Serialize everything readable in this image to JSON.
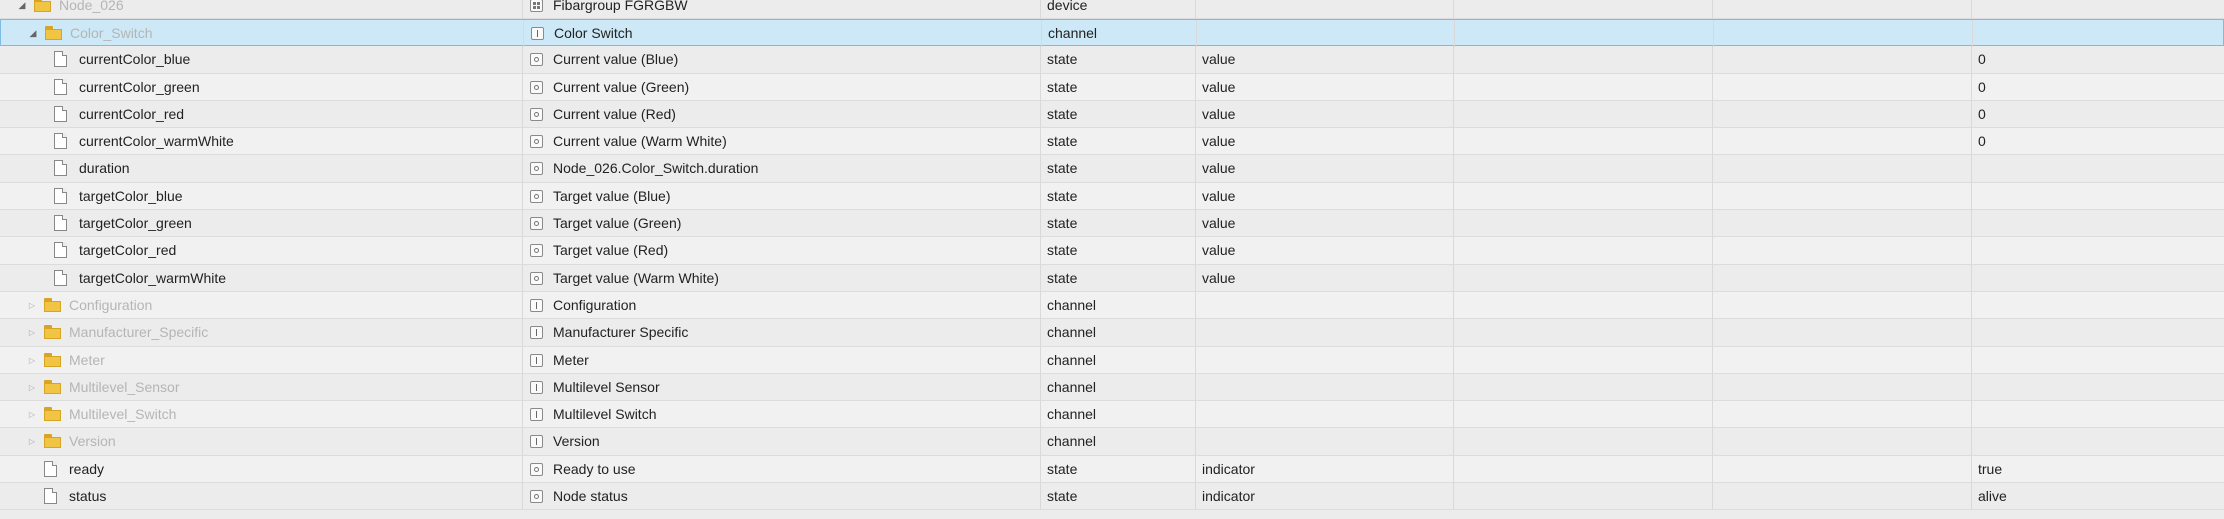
{
  "rows": [
    {
      "name": "Node_026",
      "name_muted": true,
      "icon": "folder",
      "toggle": "expanded",
      "level": 1,
      "title": "Fibargroup FGRGBW",
      "title_icon": "device",
      "type": "device",
      "role": "",
      "value": ""
    },
    {
      "name": "Color_Switch",
      "name_muted": true,
      "icon": "folder",
      "toggle": "expanded",
      "level": 2,
      "title": "Color Switch",
      "title_icon": "channel",
      "type": "channel",
      "role": "",
      "value": "",
      "selected": true
    },
    {
      "name": "currentColor_blue",
      "icon": "file",
      "level": 3,
      "title": "Current value (Blue)",
      "title_icon": "state",
      "type": "state",
      "role": "value",
      "value": "0"
    },
    {
      "name": "currentColor_green",
      "icon": "file",
      "level": 3,
      "title": "Current value (Green)",
      "title_icon": "state",
      "type": "state",
      "role": "value",
      "value": "0"
    },
    {
      "name": "currentColor_red",
      "icon": "file",
      "level": 3,
      "title": "Current value (Red)",
      "title_icon": "state",
      "type": "state",
      "role": "value",
      "value": "0"
    },
    {
      "name": "currentColor_warmWhite",
      "icon": "file",
      "level": 3,
      "title": "Current value (Warm White)",
      "title_icon": "state",
      "type": "state",
      "role": "value",
      "value": "0"
    },
    {
      "name": "duration",
      "icon": "file",
      "level": 3,
      "title": "Node_026.Color_Switch.duration",
      "title_icon": "state",
      "type": "state",
      "role": "value",
      "value": ""
    },
    {
      "name": "targetColor_blue",
      "icon": "file",
      "level": 3,
      "title": "Target value (Blue)",
      "title_icon": "state",
      "type": "state",
      "role": "value",
      "value": ""
    },
    {
      "name": "targetColor_green",
      "icon": "file",
      "level": 3,
      "title": "Target value (Green)",
      "title_icon": "state",
      "type": "state",
      "role": "value",
      "value": ""
    },
    {
      "name": "targetColor_red",
      "icon": "file",
      "level": 3,
      "title": "Target value (Red)",
      "title_icon": "state",
      "type": "state",
      "role": "value",
      "value": ""
    },
    {
      "name": "targetColor_warmWhite",
      "icon": "file",
      "level": 3,
      "title": "Target value (Warm White)",
      "title_icon": "state",
      "type": "state",
      "role": "value",
      "value": ""
    },
    {
      "name": "Configuration",
      "name_muted": true,
      "icon": "folder",
      "toggle": "collapsed",
      "level": 2,
      "title": "Configuration",
      "title_icon": "channel",
      "type": "channel",
      "role": "",
      "value": ""
    },
    {
      "name": "Manufacturer_Specific",
      "name_muted": true,
      "icon": "folder",
      "toggle": "collapsed",
      "level": 2,
      "title": "Manufacturer Specific",
      "title_icon": "channel",
      "type": "channel",
      "role": "",
      "value": ""
    },
    {
      "name": "Meter",
      "name_muted": true,
      "icon": "folder",
      "toggle": "collapsed",
      "level": 2,
      "title": "Meter",
      "title_icon": "channel",
      "type": "channel",
      "role": "",
      "value": ""
    },
    {
      "name": "Multilevel_Sensor",
      "name_muted": true,
      "icon": "folder",
      "toggle": "collapsed",
      "level": 2,
      "title": "Multilevel Sensor",
      "title_icon": "channel",
      "type": "channel",
      "role": "",
      "value": ""
    },
    {
      "name": "Multilevel_Switch",
      "name_muted": true,
      "icon": "folder",
      "toggle": "collapsed",
      "level": 2,
      "title": "Multilevel Switch",
      "title_icon": "channel",
      "type": "channel",
      "role": "",
      "value": ""
    },
    {
      "name": "Version",
      "name_muted": true,
      "icon": "folder",
      "toggle": "collapsed",
      "level": 2,
      "title": "Version",
      "title_icon": "channel",
      "type": "channel",
      "role": "",
      "value": ""
    },
    {
      "name": "ready",
      "icon": "file",
      "level": 2,
      "title": "Ready to use",
      "title_icon": "state",
      "type": "state",
      "role": "indicator",
      "value": "true"
    },
    {
      "name": "status",
      "icon": "file",
      "level": 2,
      "title": "Node status",
      "title_icon": "state",
      "type": "state",
      "role": "indicator",
      "value": "alive"
    }
  ],
  "colors": {
    "selected_bg": "#cde8f6",
    "selected_border": "#7bbbe4",
    "folder": "#f2c443",
    "muted_text": "#b5b5b5"
  }
}
